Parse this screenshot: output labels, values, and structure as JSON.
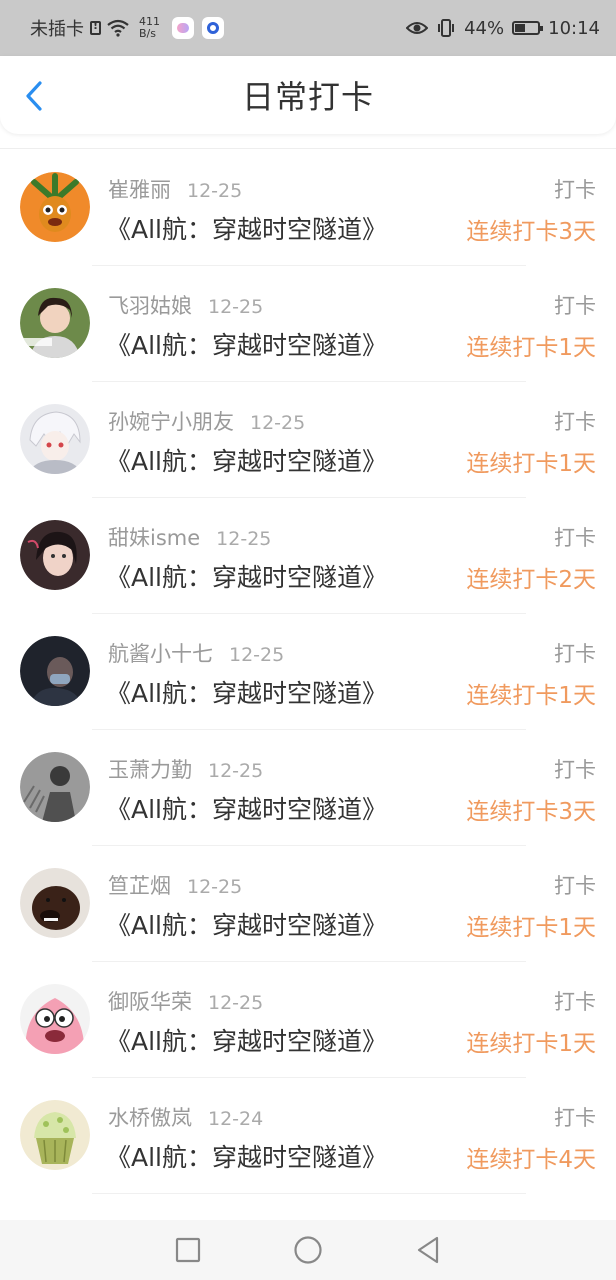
{
  "status_bar": {
    "carrier": "未插卡",
    "speed_value": "411",
    "speed_unit": "B/s",
    "battery_percent": "44%",
    "time": "10:14"
  },
  "header": {
    "title": "日常打卡"
  },
  "list": [
    {
      "name": "崔雅丽",
      "date": "12-25",
      "action": "打卡",
      "course": "《All航：穿越时空隧道》",
      "streak": "连续打卡3天"
    },
    {
      "name": "飞羽姑娘",
      "date": "12-25",
      "action": "打卡",
      "course": "《All航：穿越时空隧道》",
      "streak": "连续打卡1天"
    },
    {
      "name": "孙婉宁小朋友",
      "date": "12-25",
      "action": "打卡",
      "course": "《All航：穿越时空隧道》",
      "streak": "连续打卡1天"
    },
    {
      "name": "甜妹isme",
      "date": "12-25",
      "action": "打卡",
      "course": "《All航：穿越时空隧道》",
      "streak": "连续打卡2天"
    },
    {
      "name": "航酱小十七",
      "date": "12-25",
      "action": "打卡",
      "course": "《All航：穿越时空隧道》",
      "streak": "连续打卡1天"
    },
    {
      "name": "玉萧力勤",
      "date": "12-25",
      "action": "打卡",
      "course": "《All航：穿越时空隧道》",
      "streak": "连续打卡3天"
    },
    {
      "name": "笪芷烟",
      "date": "12-25",
      "action": "打卡",
      "course": "《All航：穿越时空隧道》",
      "streak": "连续打卡1天"
    },
    {
      "name": "御阪华荣",
      "date": "12-25",
      "action": "打卡",
      "course": "《All航：穿越时空隧道》",
      "streak": "连续打卡1天"
    },
    {
      "name": "水桥傲岚",
      "date": "12-24",
      "action": "打卡",
      "course": "《All航：穿越时空隧道》",
      "streak": "连续打卡4天"
    }
  ],
  "colors": {
    "accent_orange": "#f09a5e",
    "back_arrow_blue": "#2a8ef0",
    "status_bar_bg": "#c9c9c9"
  },
  "icons": {
    "back": "chevron-left-icon",
    "nav_recent": "square-icon",
    "nav_home": "circle-icon",
    "nav_back": "triangle-back-icon"
  }
}
